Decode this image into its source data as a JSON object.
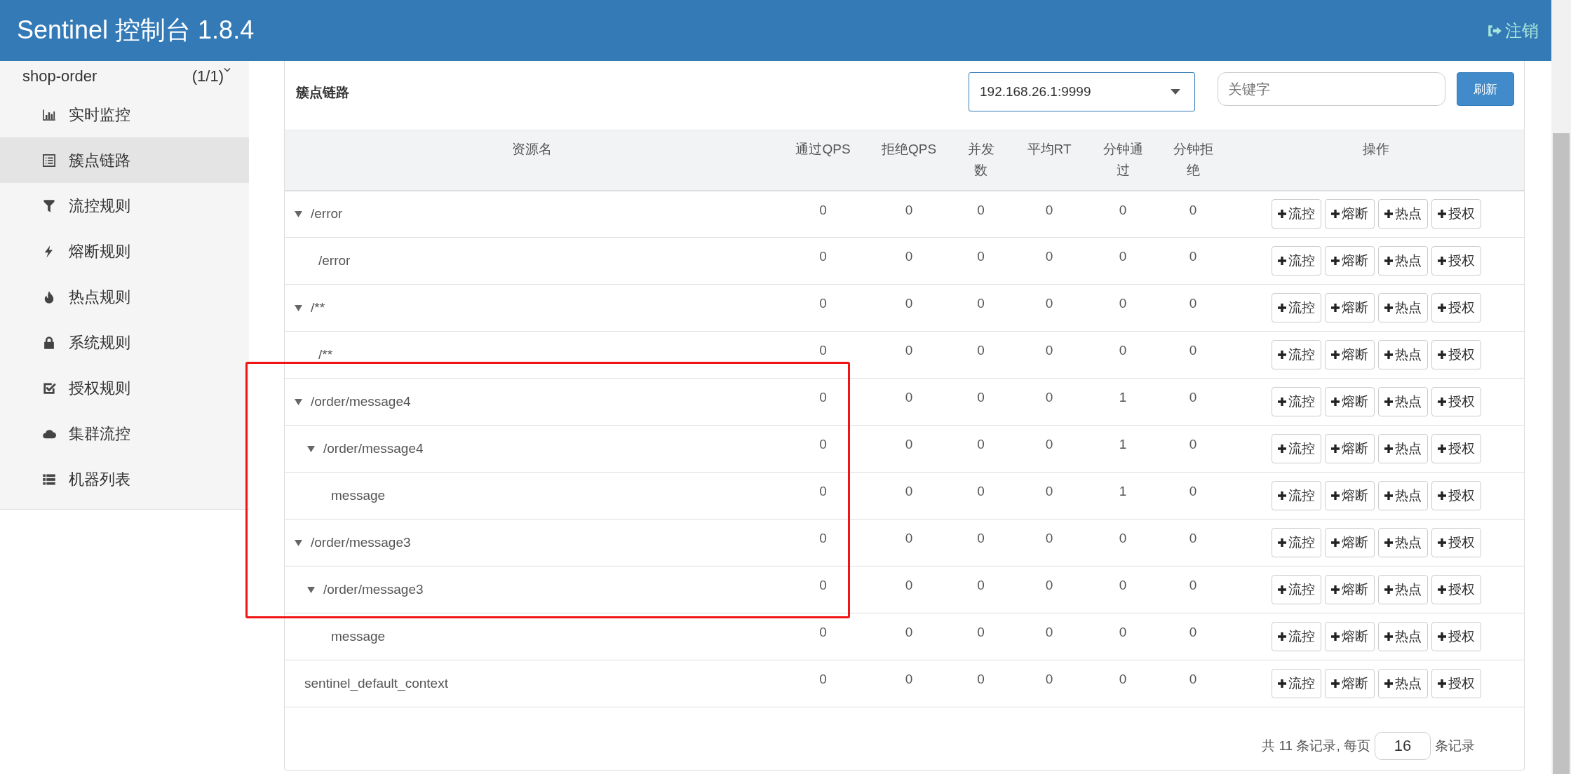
{
  "header": {
    "title": "Sentinel 控制台 1.8.4",
    "logout": "注销"
  },
  "sidebar": {
    "app": {
      "name": "shop-order",
      "count": "(1/1)"
    },
    "items": [
      {
        "label": "实时监控",
        "selected": false
      },
      {
        "label": "簇点链路",
        "selected": true
      },
      {
        "label": "流控规则",
        "selected": false
      },
      {
        "label": "熔断规则",
        "selected": false
      },
      {
        "label": "热点规则",
        "selected": false
      },
      {
        "label": "系统规则",
        "selected": false
      },
      {
        "label": "授权规则",
        "selected": false
      },
      {
        "label": "集群流控",
        "selected": false
      },
      {
        "label": "机器列表",
        "selected": false
      }
    ]
  },
  "panel": {
    "title": "簇点链路",
    "machine": "192.168.26.1:9999",
    "search": {
      "placeholder": "关键字"
    },
    "refresh": "刷新"
  },
  "table": {
    "columns": [
      "资源名",
      "通过QPS",
      "拒绝QPS",
      "并发数",
      "平均RT",
      "分钟通过",
      "分钟拒绝",
      "操作"
    ],
    "rows": [
      {
        "name": "/error",
        "expanded": true,
        "values": [
          "0",
          "0",
          "0",
          "0",
          "0",
          "0"
        ],
        "actions": [
          "流控",
          "熔断",
          "热点",
          "授权"
        ],
        "children": [
          {
            "name": "/error",
            "values": [
              "0",
              "0",
              "0",
              "0",
              "0",
              "0"
            ],
            "actions": [
              "流控",
              "熔断",
              "热点",
              "授权"
            ]
          }
        ]
      },
      {
        "name": "/**",
        "expanded": true,
        "values": [
          "0",
          "0",
          "0",
          "0",
          "0",
          "0"
        ],
        "actions": [
          "流控",
          "熔断",
          "热点",
          "授权"
        ],
        "children": [
          {
            "name": "/**",
            "values": [
              "0",
              "0",
              "0",
              "0",
              "0",
              "0"
            ],
            "actions": [
              "流控",
              "熔断",
              "热点",
              "授权"
            ]
          }
        ]
      },
      {
        "name": "/order/message4",
        "expanded": true,
        "values": [
          "0",
          "0",
          "0",
          "0",
          "1",
          "0"
        ],
        "actions": [
          "流控",
          "熔断",
          "热点",
          "授权"
        ],
        "children": [
          {
            "name": "/order/message4",
            "expanded": true,
            "values": [
              "0",
              "0",
              "0",
              "0",
              "1",
              "0"
            ],
            "actions": [
              "流控",
              "熔断",
              "热点",
              "授权"
            ],
            "children": [
              {
                "name": "message",
                "values": [
                  "0",
                  "0",
                  "0",
                  "0",
                  "1",
                  "0"
                ],
                "actions": [
                  "流控",
                  "熔断",
                  "热点",
                  "授权"
                ]
              }
            ]
          }
        ]
      },
      {
        "name": "/order/message3",
        "expanded": true,
        "values": [
          "0",
          "0",
          "0",
          "0",
          "0",
          "0"
        ],
        "actions": [
          "流控",
          "熔断",
          "热点",
          "授权"
        ],
        "children": [
          {
            "name": "/order/message3",
            "expanded": true,
            "values": [
              "0",
              "0",
              "0",
              "0",
              "0",
              "0"
            ],
            "actions": [
              "流控",
              "熔断",
              "热点",
              "授权"
            ],
            "children": [
              {
                "name": "message",
                "values": [
                  "0",
                  "0",
                  "0",
                  "0",
                  "0",
                  "0"
                ],
                "actions": [
                  "流控",
                  "熔断",
                  "热点",
                  "授权"
                ]
              }
            ]
          }
        ]
      },
      {
        "name": "sentinel_default_context",
        "values": [
          "0",
          "0",
          "0",
          "0",
          "0",
          "0"
        ],
        "actions": [
          "流控",
          "熔断",
          "热点",
          "授权"
        ]
      }
    ]
  },
  "pagination": {
    "before": "共 11 条记录, 每页",
    "page_size": "16",
    "after": "条记录"
  }
}
